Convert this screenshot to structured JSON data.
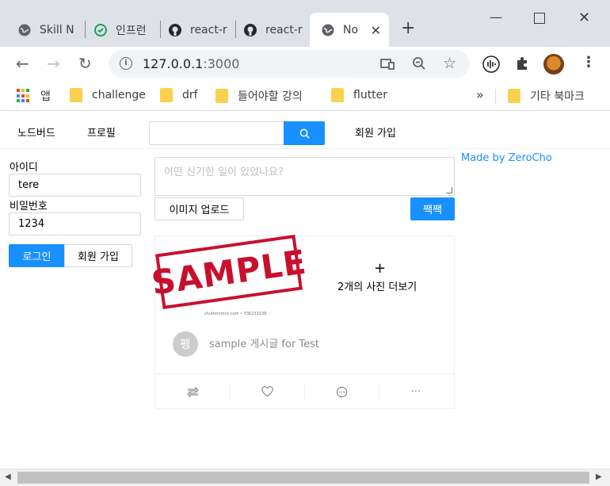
{
  "browser": {
    "tabs": [
      {
        "label": "Skill N",
        "icon": "globe-icon"
      },
      {
        "label": "인프런",
        "icon": "inflearn-icon"
      },
      {
        "label": "react-r",
        "icon": "github-icon"
      },
      {
        "label": "react-r",
        "icon": "github-icon"
      },
      {
        "label": "No",
        "icon": "globe-icon",
        "active": true
      }
    ],
    "new_tab": "+",
    "address": {
      "host": "127.0.0.1",
      "port": ":3000"
    },
    "bookmarks": [
      {
        "label": "앱",
        "icon": "apps-grid-icon"
      },
      {
        "label": "challenge",
        "icon": "folder-icon"
      },
      {
        "label": "drf",
        "icon": "folder-icon"
      },
      {
        "label": "들어야할 강의",
        "icon": "folder-icon"
      },
      {
        "label": "flutter",
        "icon": "folder-icon"
      },
      {
        "label": "기타 북마크",
        "icon": "folder-icon"
      }
    ],
    "bookmarks_overflow": "»"
  },
  "app_nav": {
    "home": "노드버드",
    "profile": "프로필",
    "search_value": "",
    "signup": "회원 가입"
  },
  "login": {
    "id_label": "아이디",
    "id_value": "tere",
    "password_label": "비밀번호",
    "password_value": "1234",
    "login_button": "로그인",
    "signup_button": "회원 가입"
  },
  "post_form": {
    "placeholder": "어떤 신기한 일이 있었나요?",
    "upload_button": "이미지 업로드",
    "submit_button": "짹짹"
  },
  "post": {
    "image_text": "SAMPLE",
    "image_caption": "shutterstock.com • 336233238",
    "more_images": "2개의 사진 더보기",
    "more_plus": "+",
    "author_initial": "펭",
    "content": "sample 게시글 for Test",
    "actions": [
      "retweet-icon",
      "heart-icon",
      "message-icon",
      "ellipsis-icon"
    ],
    "ellipsis": "···"
  },
  "credit": "Made by ZeroCho",
  "colors": {
    "primary": "#1890ff",
    "stamp_red": "#c8102e",
    "chrome_tabbar": "#dee1e6"
  }
}
